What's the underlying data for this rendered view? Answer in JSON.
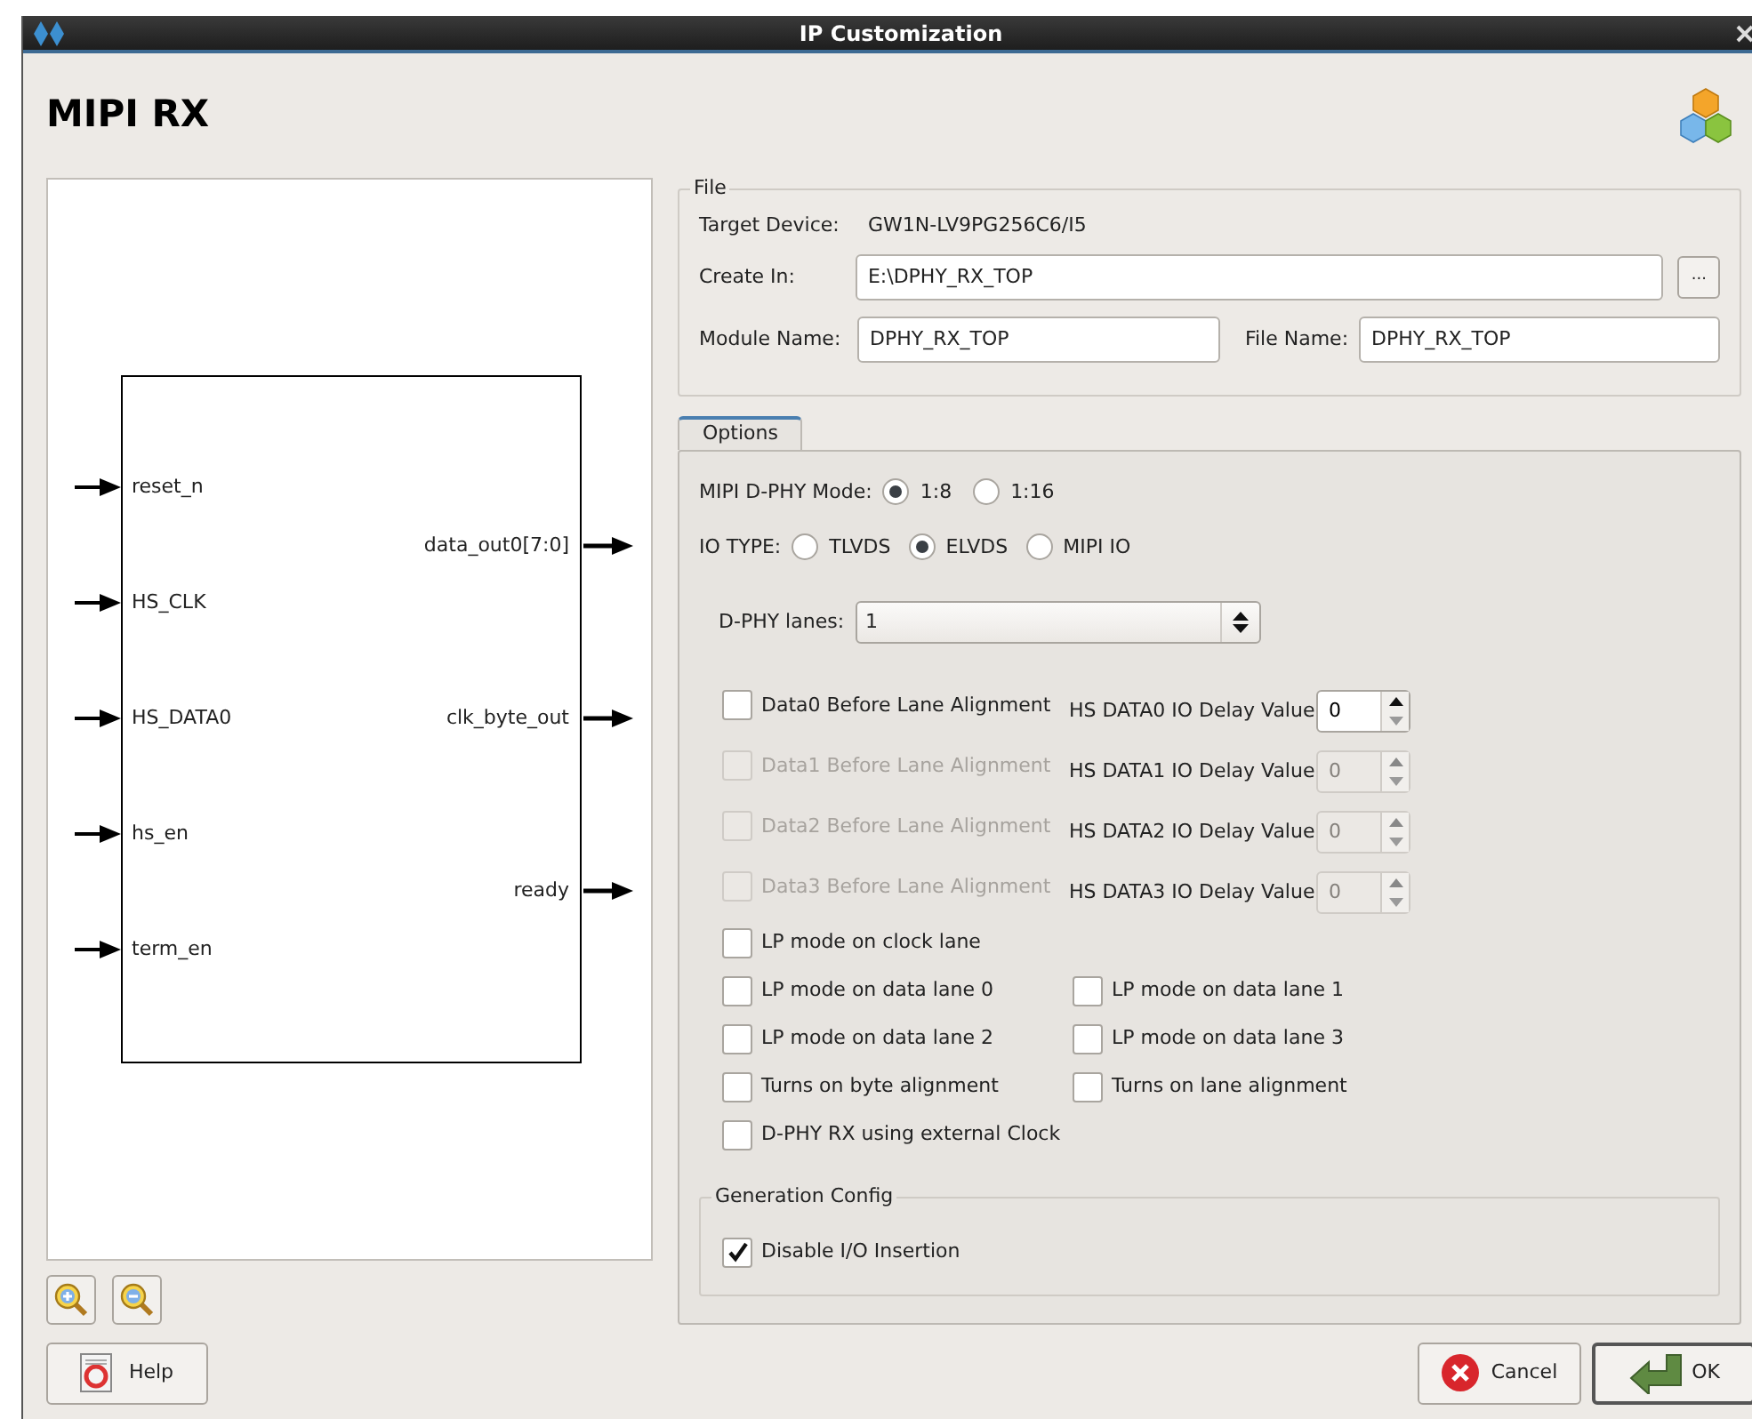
{
  "window": {
    "title": "IP Customization"
  },
  "header": {
    "title": "MIPI RX"
  },
  "diagram": {
    "inputs": [
      "reset_n",
      "HS_CLK",
      "HS_DATA0",
      "hs_en",
      "term_en"
    ],
    "outputs": [
      "data_out0[7:0]",
      "clk_byte_out",
      "ready"
    ]
  },
  "file": {
    "legend": "File",
    "target_device": {
      "label": "Target Device:",
      "value": "GW1N-LV9PG256C6/I5"
    },
    "create_in": {
      "label": "Create In:",
      "value": "E:\\DPHY_RX_TOP"
    },
    "browse": "...",
    "module_name": {
      "label": "Module Name:",
      "value": "DPHY_RX_TOP"
    },
    "file_name": {
      "label": "File Name:",
      "value": "DPHY_RX_TOP"
    }
  },
  "tabs": [
    {
      "label": "Options",
      "selected": true
    }
  ],
  "options": {
    "mode": {
      "label": "MIPI D-PHY Mode:",
      "choices": [
        {
          "label": "1:8",
          "selected": true
        },
        {
          "label": "1:16",
          "selected": false
        }
      ]
    },
    "io_type": {
      "label": "IO TYPE:",
      "choices": [
        {
          "label": "TLVDS",
          "selected": false
        },
        {
          "label": "ELVDS",
          "selected": true
        },
        {
          "label": "MIPI IO",
          "selected": false
        }
      ]
    },
    "lanes": {
      "label": "D-PHY lanes:",
      "value": "1"
    },
    "data_rows": [
      {
        "label": "Data0 Before Lane Alignment",
        "checked": false,
        "disabled": false,
        "delay_label": "HS DATA0 IO Delay Value",
        "delay_value": "0"
      },
      {
        "label": "Data1 Before Lane Alignment",
        "checked": false,
        "disabled": true,
        "delay_label": "HS DATA1 IO Delay Value",
        "delay_value": "0"
      },
      {
        "label": "Data2 Before Lane Alignment",
        "checked": false,
        "disabled": true,
        "delay_label": "HS DATA2 IO Delay Value",
        "delay_value": "0"
      },
      {
        "label": "Data3 Before Lane Alignment",
        "checked": false,
        "disabled": true,
        "delay_label": "HS DATA3 IO Delay Value",
        "delay_value": "0"
      }
    ],
    "checkbox_rows": [
      {
        "items": [
          {
            "label": "LP mode on clock lane",
            "checked": false
          }
        ]
      },
      {
        "items": [
          {
            "label": "LP mode on data lane 0",
            "checked": false
          },
          {
            "label": "LP mode on data lane 1",
            "checked": false
          }
        ]
      },
      {
        "items": [
          {
            "label": "LP mode on data lane 2",
            "checked": false
          },
          {
            "label": "LP mode on data lane 3",
            "checked": false
          }
        ]
      },
      {
        "items": [
          {
            "label": "Turns on byte alignment",
            "checked": false
          },
          {
            "label": "Turns on lane alignment",
            "checked": false
          }
        ]
      },
      {
        "items": [
          {
            "label": "D-PHY RX using external Clock",
            "checked": false
          }
        ]
      }
    ],
    "generation_config": {
      "legend": "Generation Config",
      "items": [
        {
          "label": "Disable I/O Insertion",
          "checked": true
        }
      ]
    }
  },
  "buttons": {
    "help": "Help",
    "cancel": "Cancel",
    "ok": "OK"
  }
}
